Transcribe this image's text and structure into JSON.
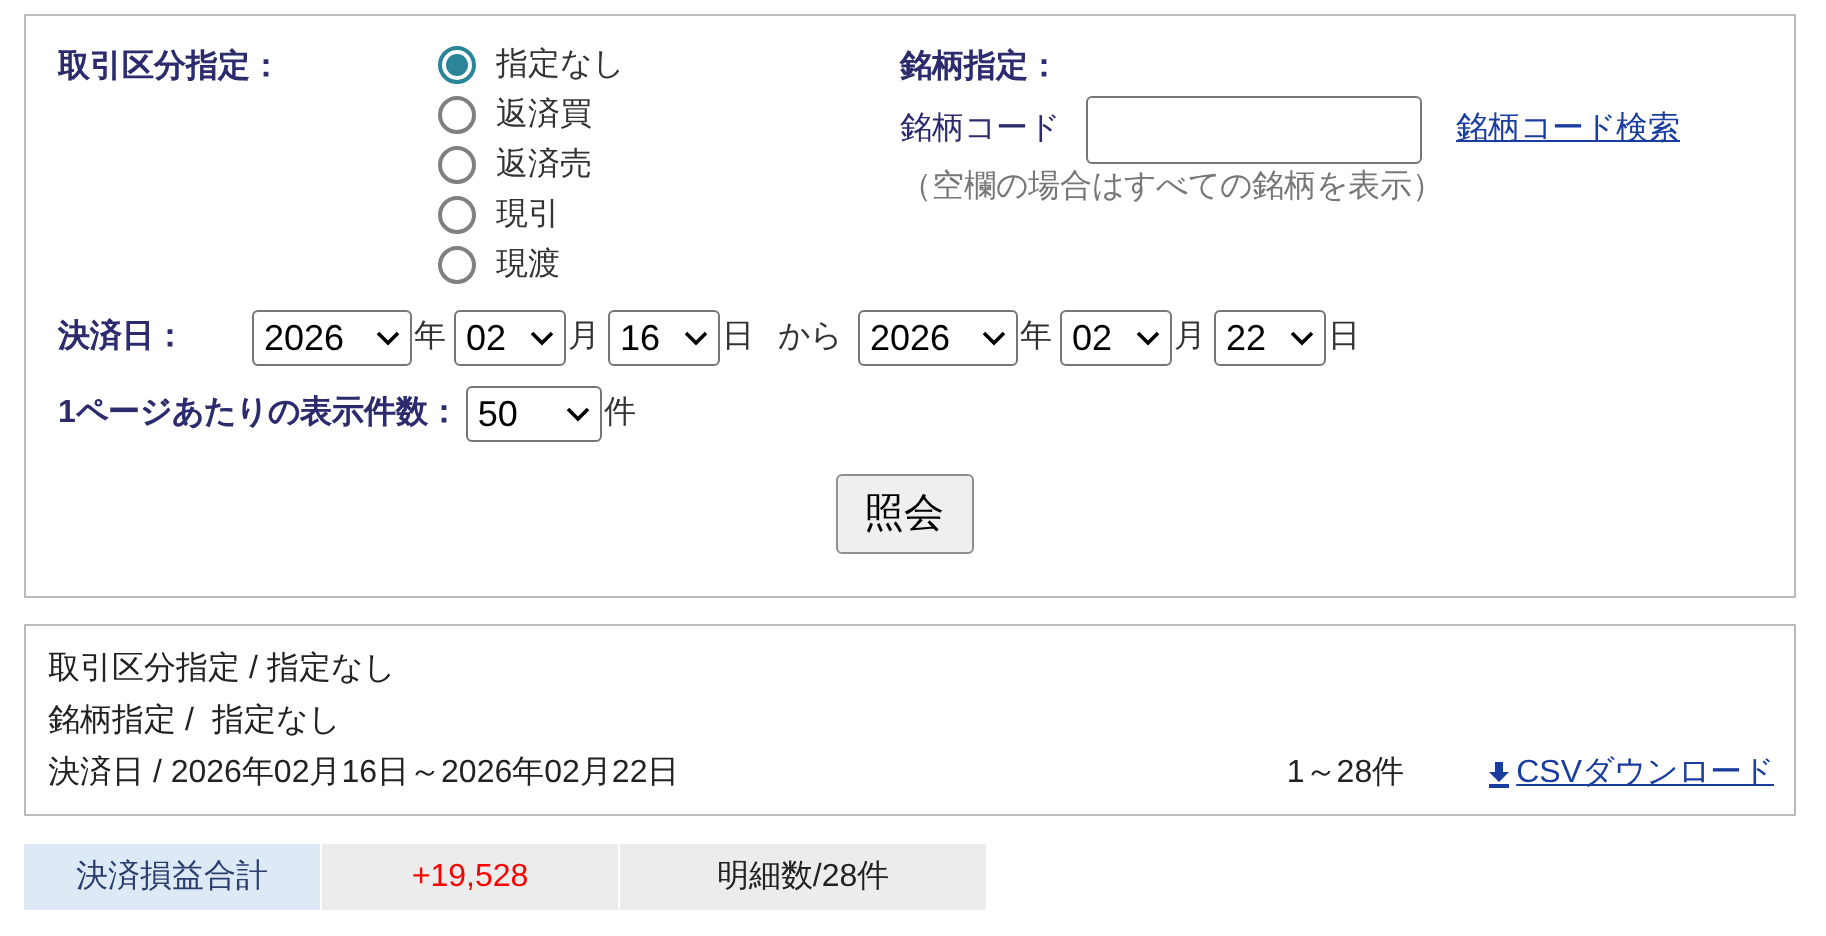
{
  "search_form": {
    "trade_type": {
      "label": "取引区分指定：",
      "options": [
        {
          "label": "指定なし",
          "selected": true
        },
        {
          "label": "返済買",
          "selected": false
        },
        {
          "label": "返済売",
          "selected": false
        },
        {
          "label": "現引",
          "selected": false
        },
        {
          "label": "現渡",
          "selected": false
        }
      ]
    },
    "symbol": {
      "label": "銘柄指定：",
      "code_label": "銘柄コード",
      "search_link": "銘柄コード検索",
      "note": "（空欄の場合はすべての銘柄を表示）"
    },
    "settlement_date": {
      "label": "決済日：",
      "from": [
        {
          "value": "2026",
          "unit": "年"
        },
        {
          "value": "02",
          "unit": "月"
        },
        {
          "value": "16",
          "unit": "日"
        }
      ],
      "separator": "から",
      "to": [
        {
          "value": "2026",
          "unit": "年"
        },
        {
          "value": "02",
          "unit": "月"
        },
        {
          "value": "22",
          "unit": "日"
        }
      ]
    },
    "per_page": {
      "label": "1ページあたりの表示件数：",
      "value": "50",
      "unit": "件"
    },
    "submit": "照会"
  },
  "conditions": {
    "lines": [
      "取引区分指定 / 指定なし",
      "銘柄指定 /  指定なし",
      "決済日 / 2026年02月16日～2026年02月22日"
    ],
    "count": "1～28件",
    "csv_link": "CSVダウンロード"
  },
  "totals": {
    "label": "決済損益合計",
    "value": "+19,528",
    "positive": true,
    "details": "明細数/28件"
  }
}
